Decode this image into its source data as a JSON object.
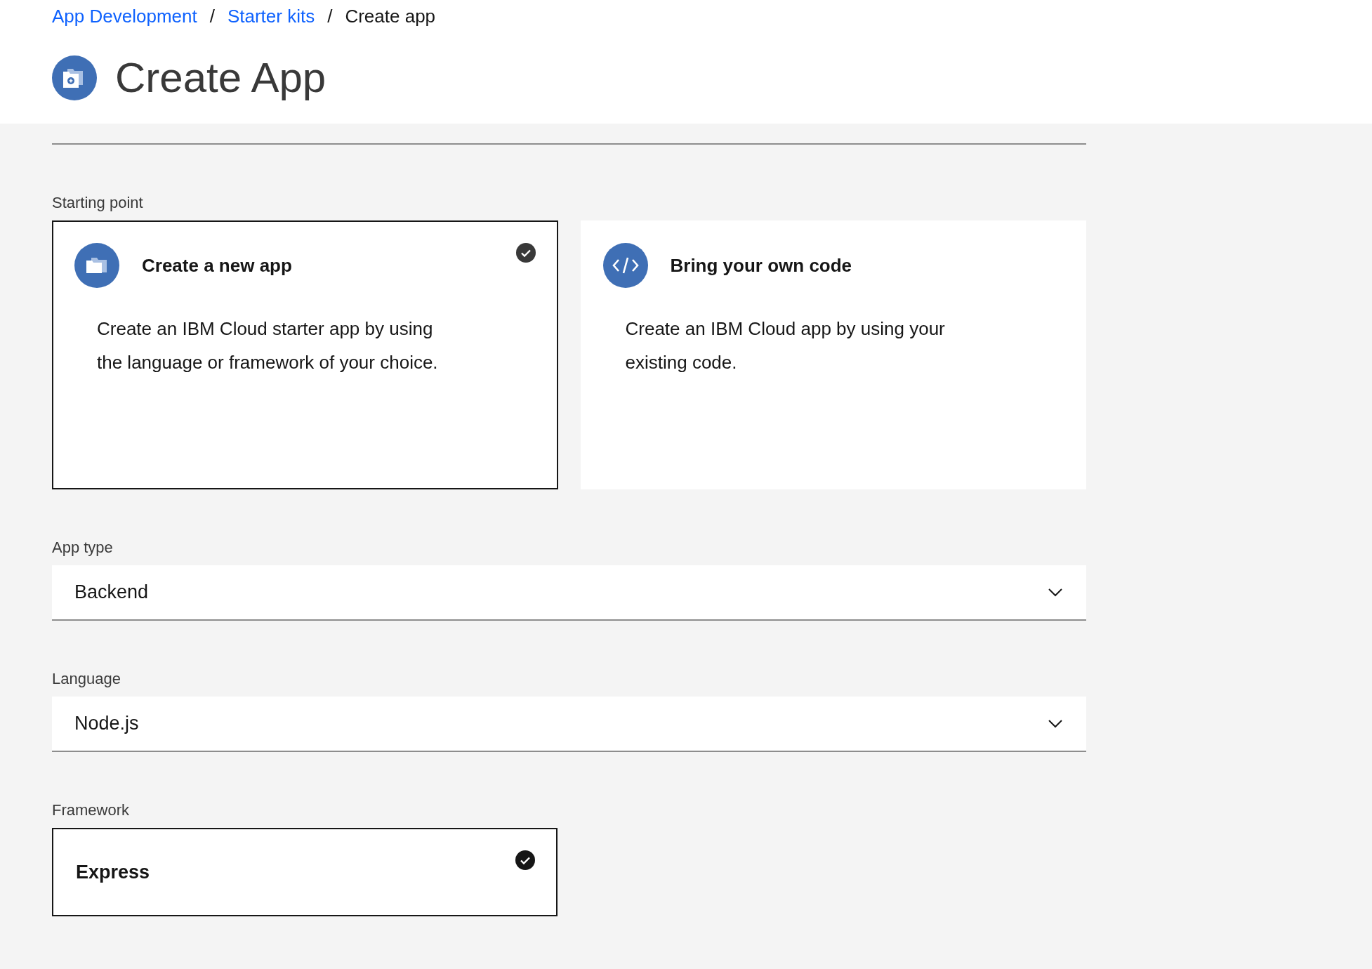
{
  "breadcrumb": [
    {
      "label": "App Development",
      "link": true
    },
    {
      "separator": "/"
    },
    {
      "label": "Starter kits",
      "link": true
    },
    {
      "separator": "/"
    },
    {
      "label": "Create app",
      "link": false
    }
  ],
  "page_title": "Create App",
  "starting_point": {
    "label": "Starting point",
    "options": [
      {
        "kind": "folder",
        "title": "Create a new app",
        "description": "Create an IBM Cloud starter app by using the language or framework of your choice.",
        "selected": true
      },
      {
        "kind": "code",
        "title": "Bring your own code",
        "description": "Create an IBM Cloud app by using your existing code.",
        "selected": false
      }
    ]
  },
  "selects": [
    {
      "label": "App type",
      "value": "Backend"
    },
    {
      "label": "Language",
      "value": "Node.js"
    }
  ],
  "framework": {
    "label": "Framework",
    "options": [
      {
        "title": "Express",
        "selected": true
      }
    ]
  }
}
